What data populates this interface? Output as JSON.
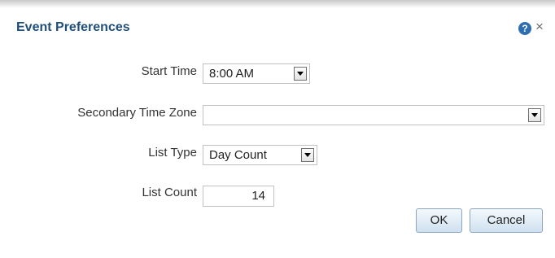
{
  "dialog": {
    "title": "Event Preferences",
    "help_icon_glyph": "?",
    "close_icon_glyph": "×"
  },
  "form": {
    "start_time": {
      "label": "Start Time",
      "value": "8:00 AM"
    },
    "secondary_time_zone": {
      "label": "Secondary Time Zone",
      "value": ""
    },
    "list_type": {
      "label": "List Type",
      "value": "Day Count"
    },
    "list_count": {
      "label": "List Count",
      "value": "14"
    }
  },
  "buttons": {
    "ok": "OK",
    "cancel": "Cancel"
  },
  "icons": {
    "help": "help-icon",
    "close": "close-icon",
    "dropdown": "chevron-down-icon"
  },
  "colors": {
    "title": "#1f4f7a",
    "help_icon_bg": "#2f6db2",
    "button_border": "#8aa6c1"
  }
}
